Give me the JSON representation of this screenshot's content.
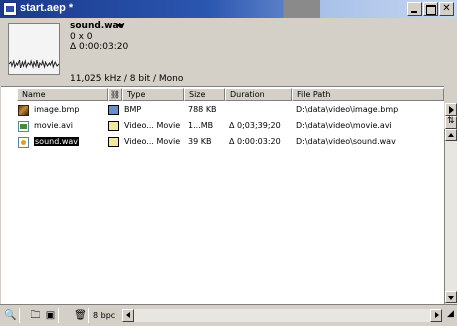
{
  "window": {
    "title": "start.aep *",
    "minimize_icon": "minimize-icon",
    "maximize_icon": "maximize-icon",
    "close_icon": "close-icon"
  },
  "info": {
    "name": "sound.wav",
    "dimensions": "0 x 0",
    "duration": "Δ 0:00:03:20",
    "specs": "11,025 kHz / 8 bit / Mono"
  },
  "table": {
    "headers": {
      "name": "Name",
      "type": "Type",
      "size": "Size",
      "duration": "Duration",
      "file_path": "File Path"
    },
    "rows": [
      {
        "name": "image.bmp",
        "icon": "image-file-icon",
        "label_color": "#6890c8",
        "type": "BMP",
        "size": "788 KB",
        "duration": "",
        "path": "D:\\data\\video\\image.bmp",
        "selected": false
      },
      {
        "name": "movie.avi",
        "icon": "movie-file-icon",
        "label_color": "#f0e8a0",
        "type": "Video... Movie",
        "size": "1...MB",
        "duration": "Δ 0;03;39;20",
        "path": "D:\\data\\video\\movie.avi",
        "selected": false
      },
      {
        "name": "sound.wav",
        "icon": "sound-file-icon",
        "label_color": "#f0e8a0",
        "type": "Video... Movie",
        "size": "39 KB",
        "duration": "Δ 0:00:03:20",
        "path": "D:\\data\\video\\sound.wav",
        "selected": true
      }
    ]
  },
  "toolbar": {
    "bit_depth": "8 bpc"
  }
}
